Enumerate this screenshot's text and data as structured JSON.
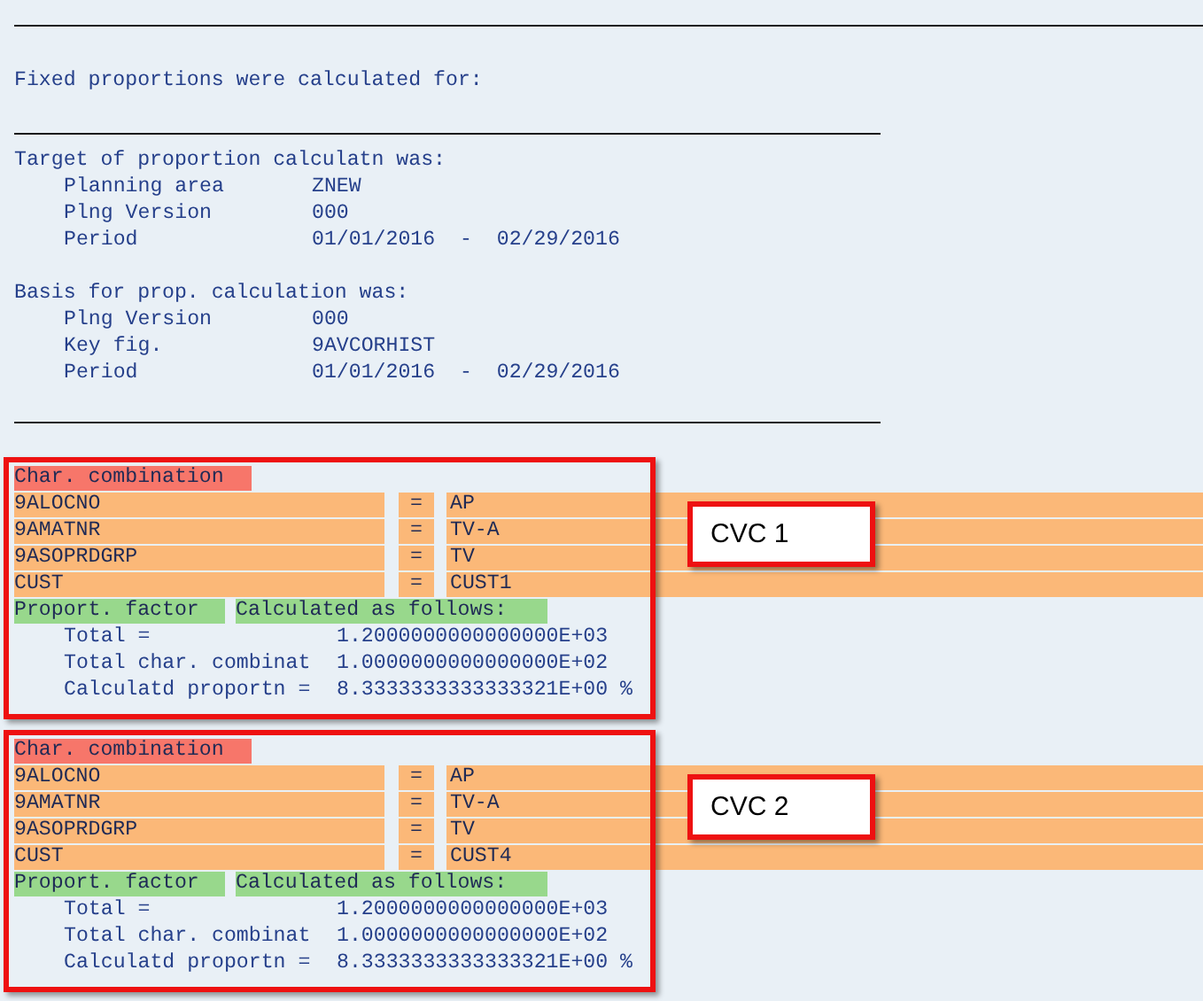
{
  "title": "Fixed proportions were calculated for:",
  "sections": [
    {
      "heading": "Target of proportion calculatn was:",
      "rows": [
        {
          "label": "Planning area",
          "value": "ZNEW"
        },
        {
          "label": "Plng Version",
          "value": "000"
        },
        {
          "label": "Period",
          "value": "01/01/2016  -  02/29/2016"
        }
      ]
    },
    {
      "heading": "Basis for prop. calculation was:",
      "rows": [
        {
          "label": "Plng Version",
          "value": "000"
        },
        {
          "label": "Key fig.",
          "value": "9AVCORHIST"
        },
        {
          "label": "Period",
          "value": "01/01/2016  -  02/29/2016"
        }
      ]
    }
  ],
  "combinations": [
    {
      "heading": "Char. combination",
      "annotation": "CVC 1",
      "chars": [
        {
          "name": "9ALOCNO",
          "op": "=",
          "value": "AP"
        },
        {
          "name": "9AMATNR",
          "op": "=",
          "value": "TV-A"
        },
        {
          "name": "9ASOPRDGRP",
          "op": "=",
          "value": "TV"
        },
        {
          "name": "CUST",
          "op": "=",
          "value": "CUST1"
        }
      ],
      "factor_label": "Proport. factor",
      "calc_label": "Calculated as follows:",
      "results": [
        {
          "label": "Total =",
          "value": "1.2000000000000000E+03"
        },
        {
          "label": "Total char. combinat",
          "value": "1.0000000000000000E+02"
        },
        {
          "label": "Calculatd proportn =",
          "value": "8.3333333333333321E+00 %"
        }
      ]
    },
    {
      "heading": "Char. combination",
      "annotation": "CVC 2",
      "chars": [
        {
          "name": "9ALOCNO",
          "op": "=",
          "value": "AP"
        },
        {
          "name": "9AMATNR",
          "op": "=",
          "value": "TV-A"
        },
        {
          "name": "9ASOPRDGRP",
          "op": "=",
          "value": "TV"
        },
        {
          "name": "CUST",
          "op": "=",
          "value": "CUST4"
        }
      ],
      "factor_label": "Proport. factor",
      "calc_label": "Calculated as follows:",
      "results": [
        {
          "label": "Total =",
          "value": "1.2000000000000000E+03"
        },
        {
          "label": "Total char. combinat",
          "value": "1.0000000000000000E+02"
        },
        {
          "label": "Calculatd proportn =",
          "value": "8.3333333333333321E+00 %"
        }
      ]
    }
  ]
}
